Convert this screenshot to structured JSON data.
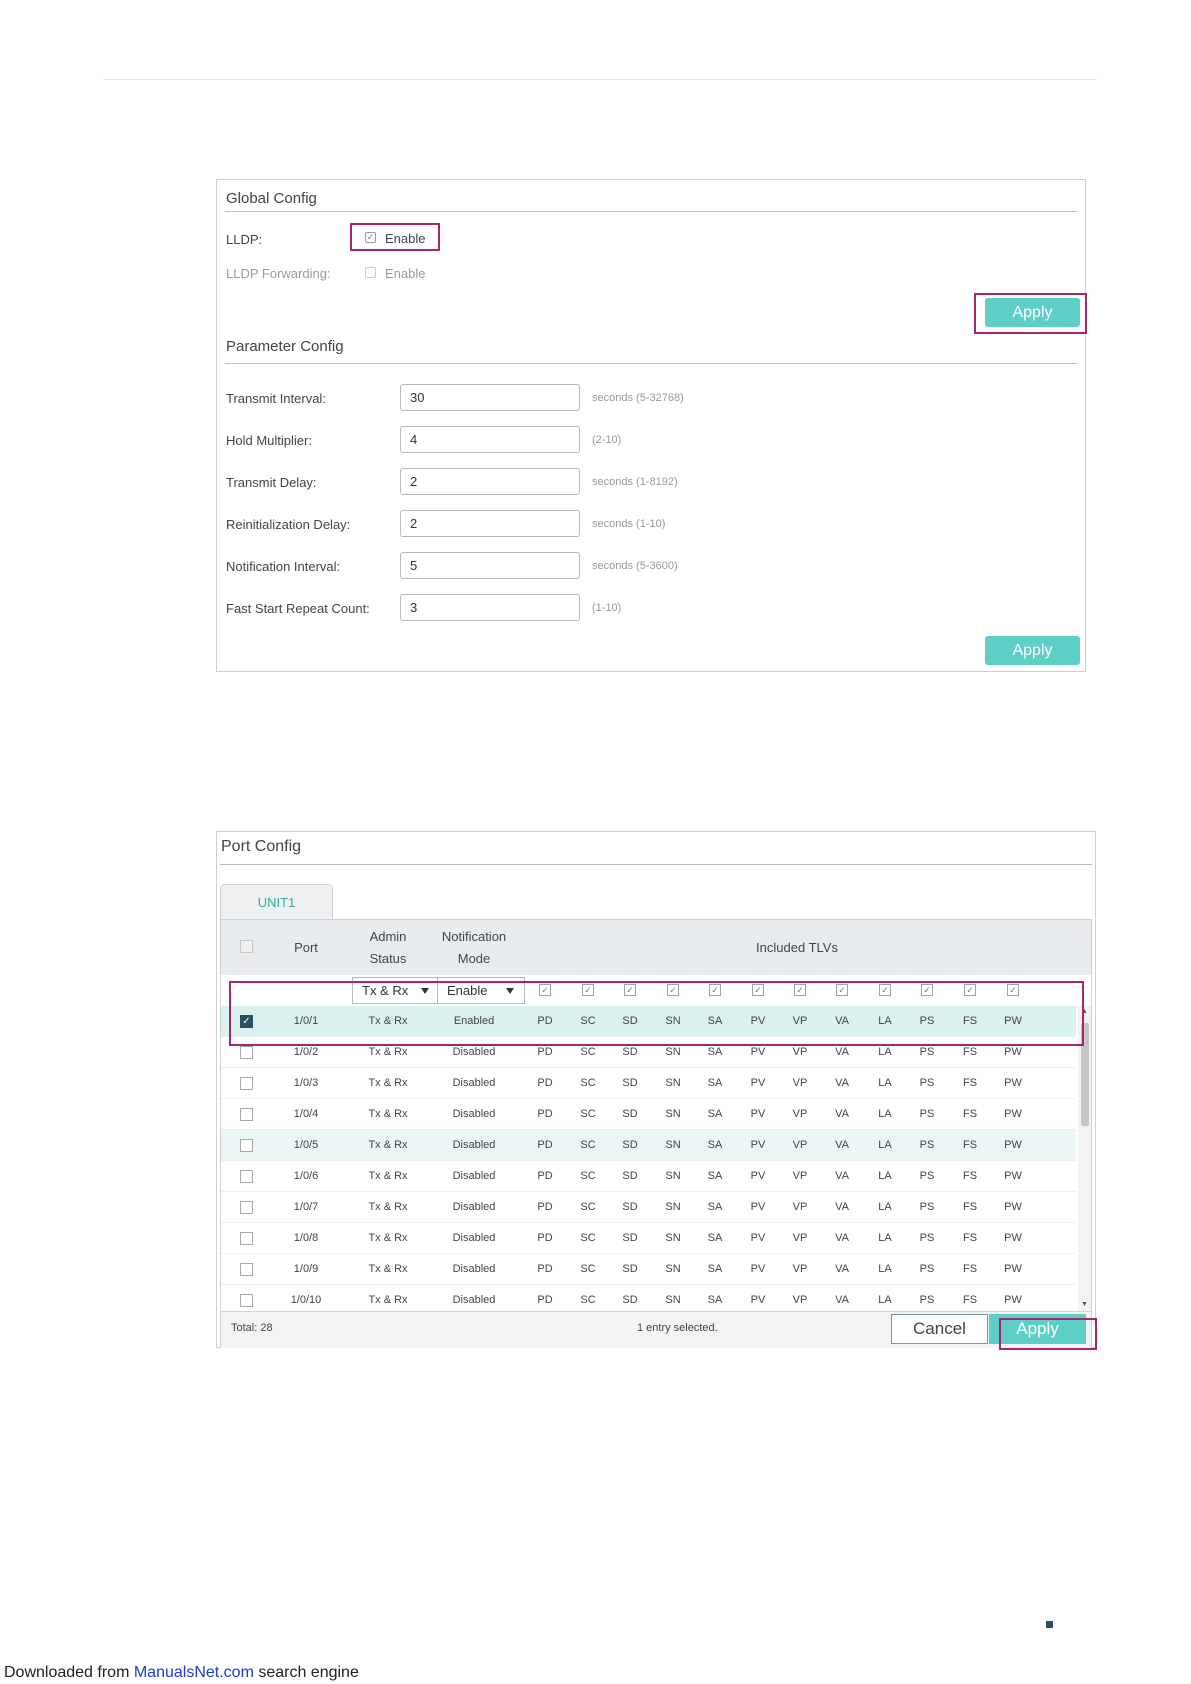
{
  "global_config": {
    "title": "Global Config",
    "lldp_label": "LLDP:",
    "lldp_checkbox": "Enable",
    "lldp_forwarding_label": "LLDP Forwarding:",
    "lldp_forwarding_checkbox": "Enable",
    "apply": "Apply"
  },
  "parameter_config": {
    "title": "Parameter Config",
    "fields": [
      {
        "label": "Transmit Interval:",
        "value": "30",
        "hint": "seconds (5-32768)"
      },
      {
        "label": "Hold Multiplier:",
        "value": "4",
        "hint": "(2-10)"
      },
      {
        "label": "Transmit Delay:",
        "value": "2",
        "hint": "seconds (1-8192)"
      },
      {
        "label": "Reinitialization Delay:",
        "value": "2",
        "hint": "seconds (1-10)"
      },
      {
        "label": "Notification Interval:",
        "value": "5",
        "hint": "seconds (5-3600)"
      },
      {
        "label": "Fast Start Repeat Count:",
        "value": "3",
        "hint": "(1-10)"
      }
    ],
    "apply": "Apply"
  },
  "port_config": {
    "title": "Port Config",
    "tab": "UNIT1",
    "headers": {
      "port": "Port",
      "admin_status_1": "Admin",
      "admin_status_2": "Status",
      "notification_1": "Notification",
      "notification_2": "Mode",
      "tlvs": "Included TLVs"
    },
    "filter": {
      "admin_status": "Tx & Rx",
      "notification_mode": "Enable"
    },
    "tlv_names": [
      "PD",
      "SC",
      "SD",
      "SN",
      "SA",
      "PV",
      "VP",
      "VA",
      "LA",
      "PS",
      "FS",
      "PW"
    ],
    "rows": [
      {
        "port": "1/0/1",
        "status": "Tx & Rx",
        "mode": "Enabled",
        "checked": true
      },
      {
        "port": "1/0/2",
        "status": "Tx & Rx",
        "mode": "Disabled",
        "checked": false
      },
      {
        "port": "1/0/3",
        "status": "Tx & Rx",
        "mode": "Disabled",
        "checked": false
      },
      {
        "port": "1/0/4",
        "status": "Tx & Rx",
        "mode": "Disabled",
        "checked": false
      },
      {
        "port": "1/0/5",
        "status": "Tx & Rx",
        "mode": "Disabled",
        "checked": false
      },
      {
        "port": "1/0/6",
        "status": "Tx & Rx",
        "mode": "Disabled",
        "checked": false
      },
      {
        "port": "1/0/7",
        "status": "Tx & Rx",
        "mode": "Disabled",
        "checked": false
      },
      {
        "port": "1/0/8",
        "status": "Tx & Rx",
        "mode": "Disabled",
        "checked": false
      },
      {
        "port": "1/0/9",
        "status": "Tx & Rx",
        "mode": "Disabled",
        "checked": false
      },
      {
        "port": "1/0/10",
        "status": "Tx & Rx",
        "mode": "Disabled",
        "checked": false
      }
    ],
    "total": "Total: 28",
    "selection": "1 entry selected.",
    "cancel": "Cancel",
    "apply": "Apply"
  },
  "footer": {
    "prefix": "Downloaded from ",
    "link": "ManualsNet.com",
    "suffix": " search engine"
  },
  "colors": {
    "accent": "#5ecfc5",
    "highlight": "#a8256b",
    "checked": "#2f4f63"
  }
}
